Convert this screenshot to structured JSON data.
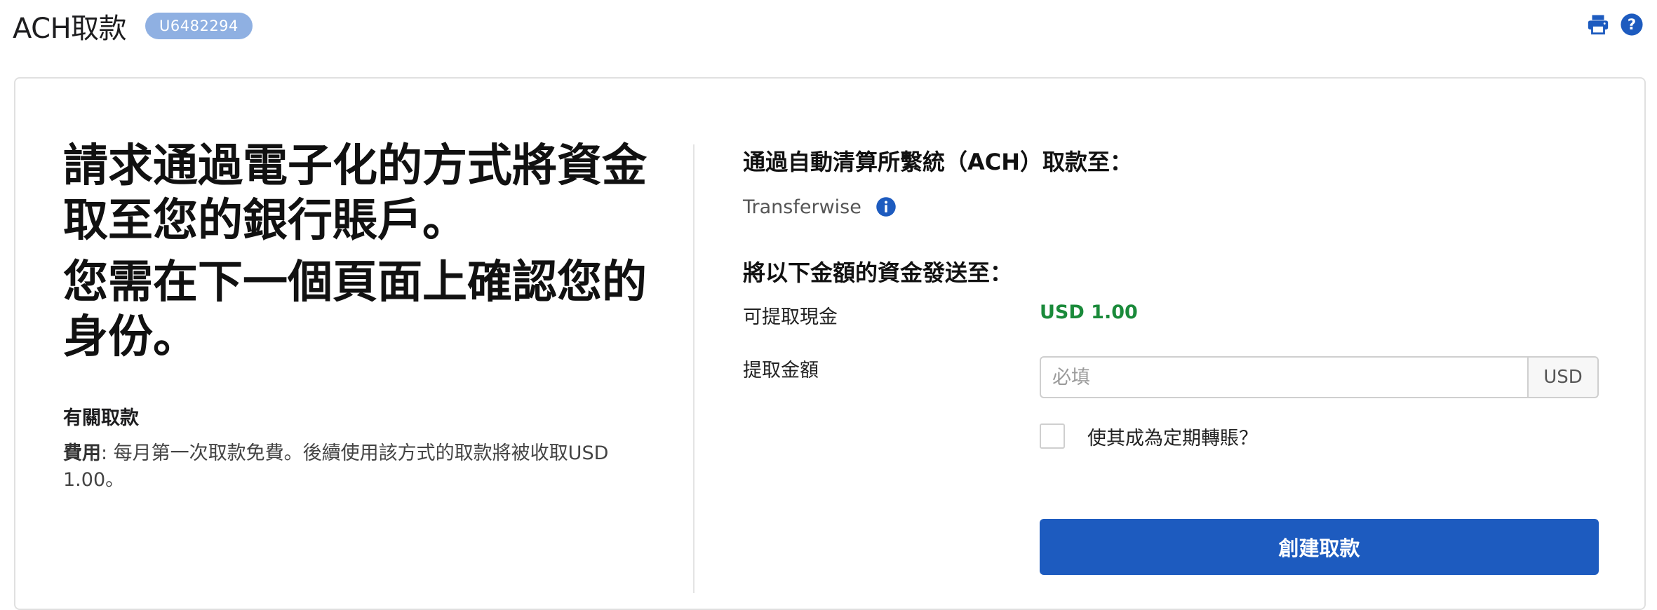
{
  "header": {
    "title": "ACH取款",
    "account_id": "U6482294",
    "icons": [
      "print-icon",
      "help-icon"
    ]
  },
  "left": {
    "hero_line1": "請求通過電子化的方式將資金取至您的銀行賬戶。",
    "hero_line2": "您需在下一個頁面上確認您的身份。",
    "about_title": "有關取款",
    "fee_label": "費用",
    "fee_text": ": 每月第一次取款免費。後續使用該方式的取款將被收取USD 1.00。"
  },
  "right": {
    "ach_title": "通過自動清算所繫統（ACH）取款至：",
    "bank_name": "Transferwise",
    "send_title": "將以下金額的資金發送至：",
    "available_label": "可提取現金",
    "available_value": "USD 1.00",
    "amount_label": "提取金額",
    "amount_value": "",
    "amount_placeholder": "必填",
    "currency": "USD",
    "recurring_label": "使其成為定期轉賬？",
    "recurring_checked": false,
    "submit_label": "創建取款"
  },
  "colors": {
    "primary": "#1d5bbf",
    "badge": "#8fb0e2",
    "positive": "#1a8a3a"
  }
}
